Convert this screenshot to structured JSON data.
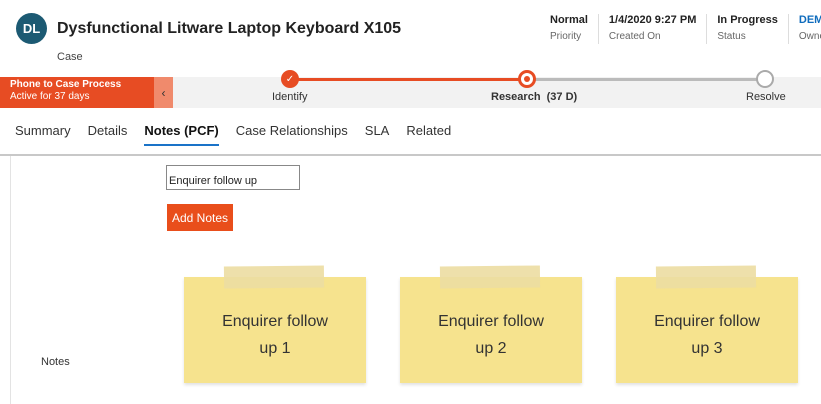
{
  "header": {
    "avatar_initials": "DL",
    "title": "Dysfunctional Litware Laptop Keyboard X105",
    "entity": "Case",
    "fields": [
      {
        "value": "Normal",
        "label": "Priority"
      },
      {
        "value": "1/4/2020 9:27 PM",
        "label": "Created On"
      },
      {
        "value": "In Progress",
        "label": "Status"
      },
      {
        "value": "DEMO",
        "label": "Owner"
      }
    ]
  },
  "process": {
    "name": "Phone to Case Process",
    "active_for": "Active for 37 days",
    "stages": [
      {
        "label": "Identify",
        "state": "completed"
      },
      {
        "label": "Research  (37 D)",
        "state": "active"
      },
      {
        "label": "Resolve",
        "state": "pending"
      }
    ]
  },
  "tabs": [
    "Summary",
    "Details",
    "Notes (PCF)",
    "Case Relationships",
    "SLA",
    "Related"
  ],
  "active_tab": "Notes (PCF)",
  "notes_section": {
    "label": "Notes",
    "input_value": "Enquirer follow up",
    "add_button": "Add Notes",
    "notes": [
      "Enquirer follow up 1",
      "Enquirer follow up 2",
      "Enquirer follow up 3"
    ]
  },
  "colors": {
    "accent": "#e74c23",
    "note_yellow": "#f6e38e",
    "tab_underline": "#1a73c8",
    "avatar": "#1c5a73"
  }
}
